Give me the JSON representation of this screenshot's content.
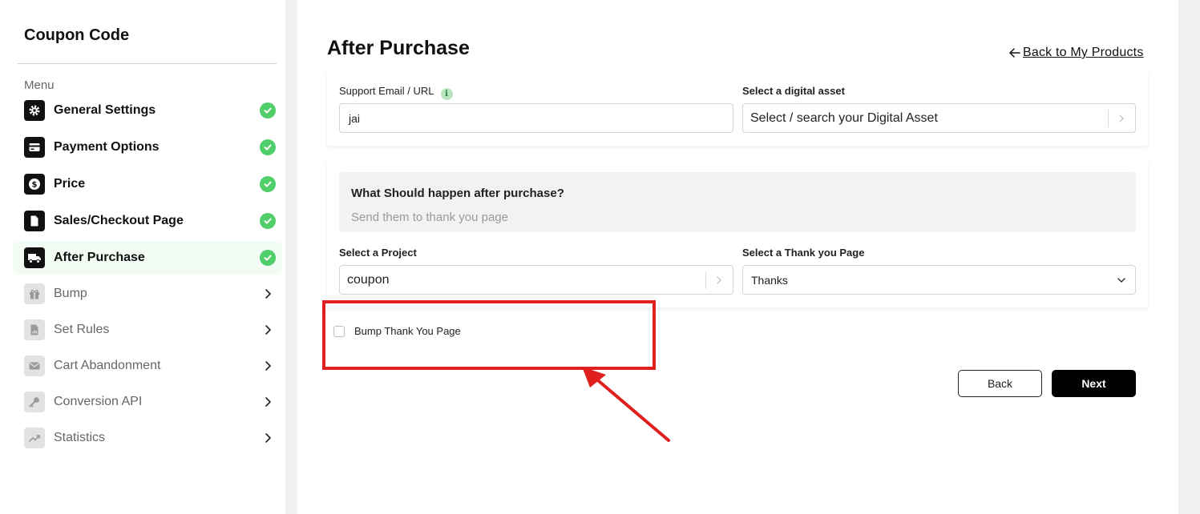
{
  "sidebar": {
    "title": "Coupon Code",
    "menu_label": "Menu",
    "items": [
      {
        "label": "General Settings",
        "icon": "gear-icon",
        "status": "complete"
      },
      {
        "label": "Payment Options",
        "icon": "card-icon",
        "status": "complete"
      },
      {
        "label": "Price",
        "icon": "dollar-icon",
        "status": "complete"
      },
      {
        "label": "Sales/Checkout Page",
        "icon": "page-icon",
        "status": "complete"
      },
      {
        "label": "After Purchase",
        "icon": "truck-icon",
        "status": "complete",
        "active": true
      },
      {
        "label": "Bump",
        "icon": "gift-icon",
        "status": "disabled"
      },
      {
        "label": "Set Rules",
        "icon": "report-icon",
        "status": "disabled"
      },
      {
        "label": "Cart Abandonment",
        "icon": "mail-icon",
        "status": "disabled"
      },
      {
        "label": "Conversion API",
        "icon": "key-icon",
        "status": "disabled"
      },
      {
        "label": "Statistics",
        "icon": "trend-icon",
        "status": "disabled"
      }
    ]
  },
  "main": {
    "title": "After Purchase",
    "back_link": "Back to My Products",
    "support": {
      "label": "Support Email / URL",
      "value": "jai"
    },
    "asset": {
      "label": "Select a digital asset",
      "value": "Select / search your Digital Asset"
    },
    "question": {
      "title": "What Should happen after purchase?",
      "subtitle": "Send them to thank you page"
    },
    "project": {
      "label": "Select a Project",
      "value": "coupon"
    },
    "thank_you": {
      "label": "Select a Thank you Page",
      "value": "Thanks"
    },
    "bump_checkbox": {
      "label": "Bump Thank You Page",
      "checked": false
    },
    "buttons": {
      "back": "Back",
      "next": "Next"
    }
  },
  "colors": {
    "accent_check": "#4fce6a",
    "highlight": "#e0201f",
    "active_bg": "#f2fbf4"
  }
}
